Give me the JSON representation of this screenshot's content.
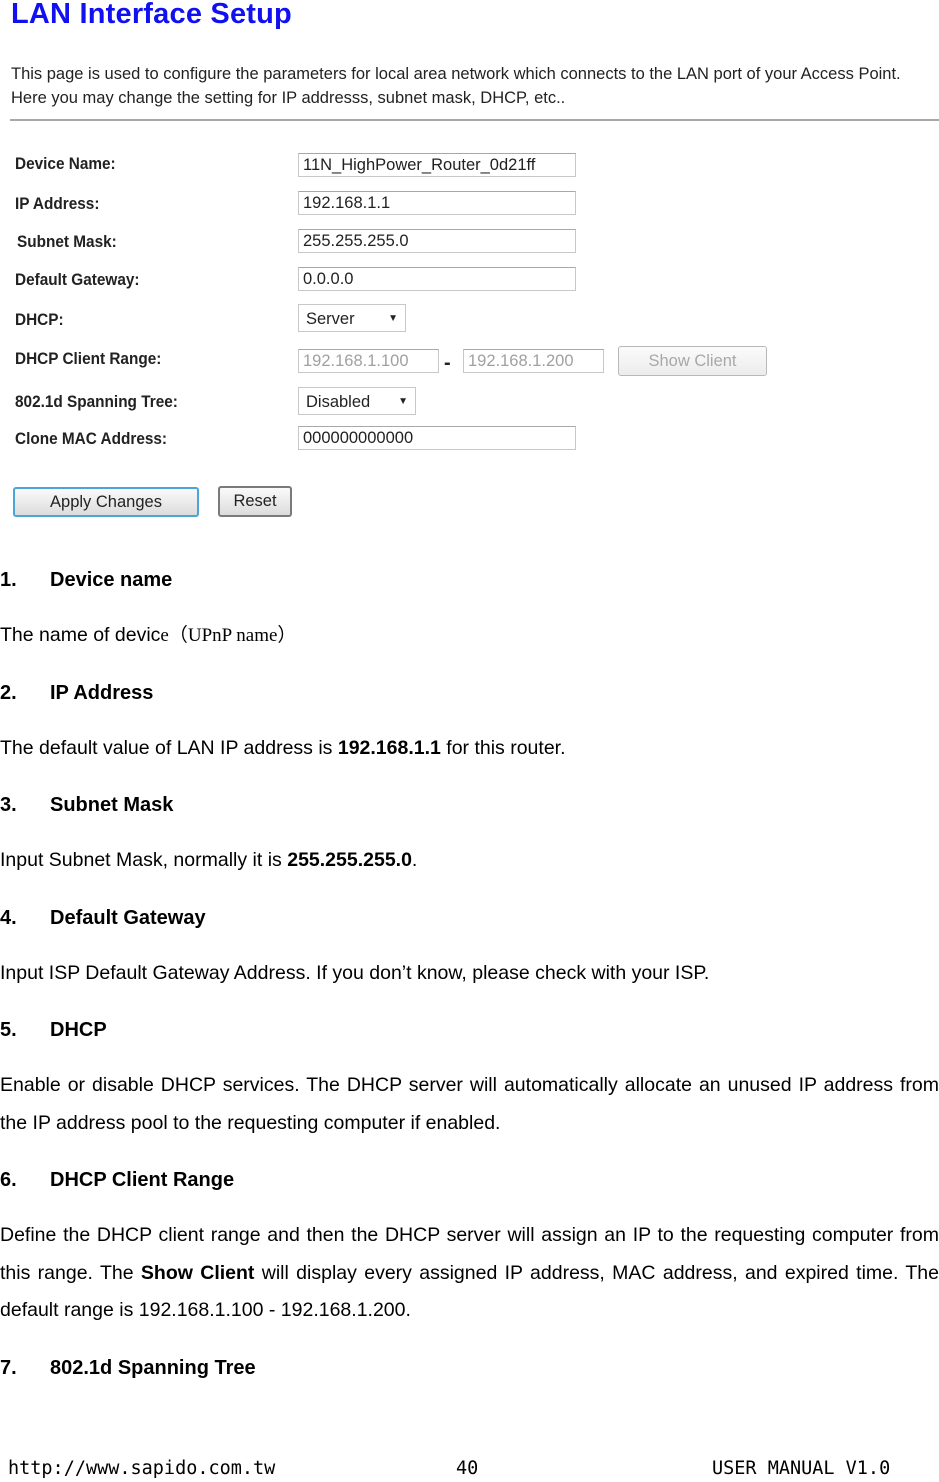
{
  "screenshot": {
    "title": "LAN Interface Setup",
    "description": "This page is used to configure the parameters for local area network which connects to the LAN port of your Access Point. Here you may change the setting for IP addresss, subnet mask, DHCP, etc..",
    "fields": {
      "device_name": {
        "label": "Device Name:",
        "value": "11N_HighPower_Router_0d21ff"
      },
      "ip_address": {
        "label": "IP Address:",
        "value": "192.168.1.1"
      },
      "subnet_mask": {
        "label": "Subnet Mask:",
        "value": "255.255.255.0"
      },
      "default_gateway": {
        "label": "Default Gateway:",
        "value": "0.0.0.0"
      },
      "dhcp": {
        "label": "DHCP:",
        "selected": "Server"
      },
      "dhcp_client_range": {
        "label": "DHCP Client Range:",
        "start": "192.168.1.100",
        "separator": "-",
        "end": "192.168.1.200",
        "show_client_label": "Show Client"
      },
      "spanning_tree": {
        "label": "802.1d Spanning Tree:",
        "selected": "Disabled"
      },
      "clone_mac": {
        "label": "Clone MAC Address:",
        "value": "000000000000"
      }
    },
    "buttons": {
      "apply": "Apply Changes",
      "reset": "Reset"
    }
  },
  "sections": [
    {
      "num": "1.",
      "title": "Device name",
      "body": "The name of devic",
      "body_tail": "e（UPnP name）"
    },
    {
      "num": "2.",
      "title": "IP Address",
      "body_pre": "The default value of LAN IP address is ",
      "body_bold": "192.168.1.1",
      "body_post": " for this router."
    },
    {
      "num": "3.",
      "title": "Subnet Mask",
      "body_pre": "Input Subnet Mask, normally it is ",
      "body_bold": "255.255.255.0",
      "body_post": "."
    },
    {
      "num": "4.",
      "title": "Default Gateway",
      "body": "Input ISP Default Gateway Address. If you don’t know, please check with your ISP."
    },
    {
      "num": "5.",
      "title": "DHCP",
      "body": "Enable or disable DHCP services. The DHCP server will automatically allocate an unused IP address from the IP address pool to the requesting computer if enabled."
    },
    {
      "num": "6.",
      "title": "DHCP Client Range",
      "body_pre": "Define the DHCP client range and then the DHCP server will assign an IP to the requesting computer from this range. The ",
      "body_bold": "Show Client",
      "body_post": " will display every assigned IP address, MAC address, and expired time. The default range is 192.168.1.100 - 192.168.1.200."
    },
    {
      "num": "7.",
      "title": "802.1d Spanning Tree"
    }
  ],
  "footer": {
    "url": "http://www.sapido.com.tw",
    "page": "40",
    "manual": "USER MANUAL V1.0"
  }
}
